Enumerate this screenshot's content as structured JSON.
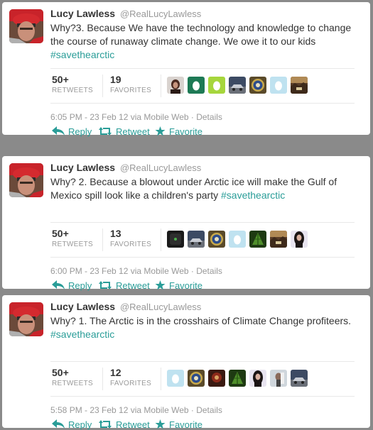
{
  "tweets": [
    {
      "name": "Lucy Lawless",
      "handle": "@RealLucyLawless",
      "text": "Why?3. Because We have the technology and knowledge to change the course of  runaway climate change. We owe it to our kids ",
      "hashtag": "#savethearctic",
      "retweets": "50+",
      "favorites": "19",
      "retweets_label": "RETWEETS",
      "favorites_label": "FAVORITES",
      "timestamp": "6:05 PM - 23 Feb 12 via Mobile Web",
      "details": "Details",
      "reply": "Reply",
      "retweet": "Retweet",
      "favorite": "Favorite",
      "faces": [
        "portrait-dark",
        "egg-green",
        "egg-lime",
        "car-dark",
        "seal-logo",
        "egg-lightblue",
        "landscape-brown"
      ]
    },
    {
      "name": "Lucy Lawless",
      "handle": "@RealLucyLawless",
      "text": "Why? 2. Because a blowout under Arctic ice will make the Gulf of Mexico spill look like a children's party ",
      "hashtag": "#savethearctic",
      "retweets": "50+",
      "favorites": "13",
      "retweets_label": "RETWEETS",
      "favorites_label": "FAVORITES",
      "timestamp": "6:00 PM - 23 Feb 12 via Mobile Web",
      "details": "Details",
      "reply": "Reply",
      "retweet": "Retweet",
      "favorite": "Favorite",
      "faces": [
        "dark-device",
        "car-dark",
        "seal-logo",
        "egg-lightblue",
        "leaf-green",
        "landscape-brown",
        "portrait-woman"
      ]
    },
    {
      "name": "Lucy Lawless",
      "handle": "@RealLucyLawless",
      "text": "Why? 1. The Arctic is in the crosshairs of Climate Change profiteers.  ",
      "hashtag": "#savethearctic",
      "retweets": "50+",
      "favorites": "12",
      "retweets_label": "RETWEETS",
      "favorites_label": "FAVORITES",
      "timestamp": "5:58 PM - 23 Feb 12 via Mobile Web",
      "details": "Details",
      "reply": "Reply",
      "retweet": "Retweet",
      "favorite": "Favorite",
      "faces": [
        "egg-lightblue",
        "seal-logo",
        "landscape-red",
        "leaf-green",
        "portrait-woman",
        "portrait-light",
        "car-dark"
      ]
    }
  ],
  "colors": {
    "link": "#2a9d98",
    "background": "#8a8a8a"
  }
}
